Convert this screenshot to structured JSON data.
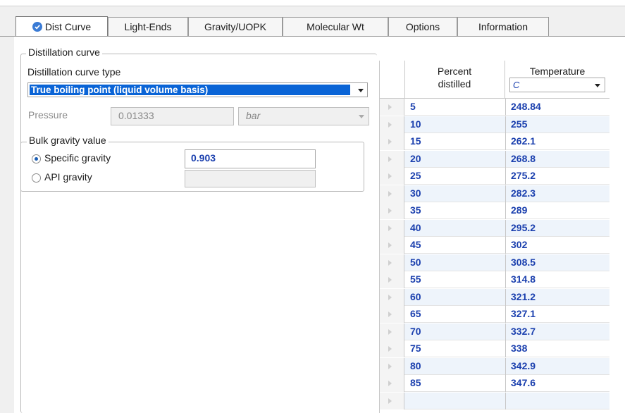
{
  "tabs": [
    {
      "label": "Dist Curve",
      "active": true,
      "icon": "check-circle-icon"
    },
    {
      "label": "Light-Ends"
    },
    {
      "label": "Gravity/UOPK"
    },
    {
      "label": "Molecular Wt"
    },
    {
      "label": "Options"
    },
    {
      "label": "Information"
    }
  ],
  "distillation": {
    "group_title": "Distillation curve",
    "type_label": "Distillation curve type",
    "type_value": "True boiling point (liquid volume basis)",
    "pressure_label": "Pressure",
    "pressure_value": "0.01333",
    "pressure_unit": "bar"
  },
  "bulk_gravity": {
    "group_title": "Bulk gravity value",
    "specific_label": "Specific gravity",
    "specific_value": "0.903",
    "api_label": "API gravity",
    "api_value": "",
    "selected": "specific"
  },
  "grid": {
    "col1_header": "Percent distilled",
    "col2_header": "Temperature",
    "col2_unit": "C",
    "rows": [
      {
        "pct": "5",
        "temp": "248.84"
      },
      {
        "pct": "10",
        "temp": "255"
      },
      {
        "pct": "15",
        "temp": "262.1"
      },
      {
        "pct": "20",
        "temp": "268.8"
      },
      {
        "pct": "25",
        "temp": "275.2"
      },
      {
        "pct": "30",
        "temp": "282.3"
      },
      {
        "pct": "35",
        "temp": "289"
      },
      {
        "pct": "40",
        "temp": "295.2"
      },
      {
        "pct": "45",
        "temp": "302"
      },
      {
        "pct": "50",
        "temp": "308.5"
      },
      {
        "pct": "55",
        "temp": "314.8"
      },
      {
        "pct": "60",
        "temp": "321.2"
      },
      {
        "pct": "65",
        "temp": "327.1"
      },
      {
        "pct": "70",
        "temp": "332.7"
      },
      {
        "pct": "75",
        "temp": "338"
      },
      {
        "pct": "80",
        "temp": "342.9"
      },
      {
        "pct": "85",
        "temp": "347.6"
      },
      {
        "pct": "",
        "temp": ""
      }
    ]
  },
  "colors": {
    "accent": "#0a64d6",
    "value_text": "#1a3fae",
    "alt_row": "#eef4fb"
  }
}
